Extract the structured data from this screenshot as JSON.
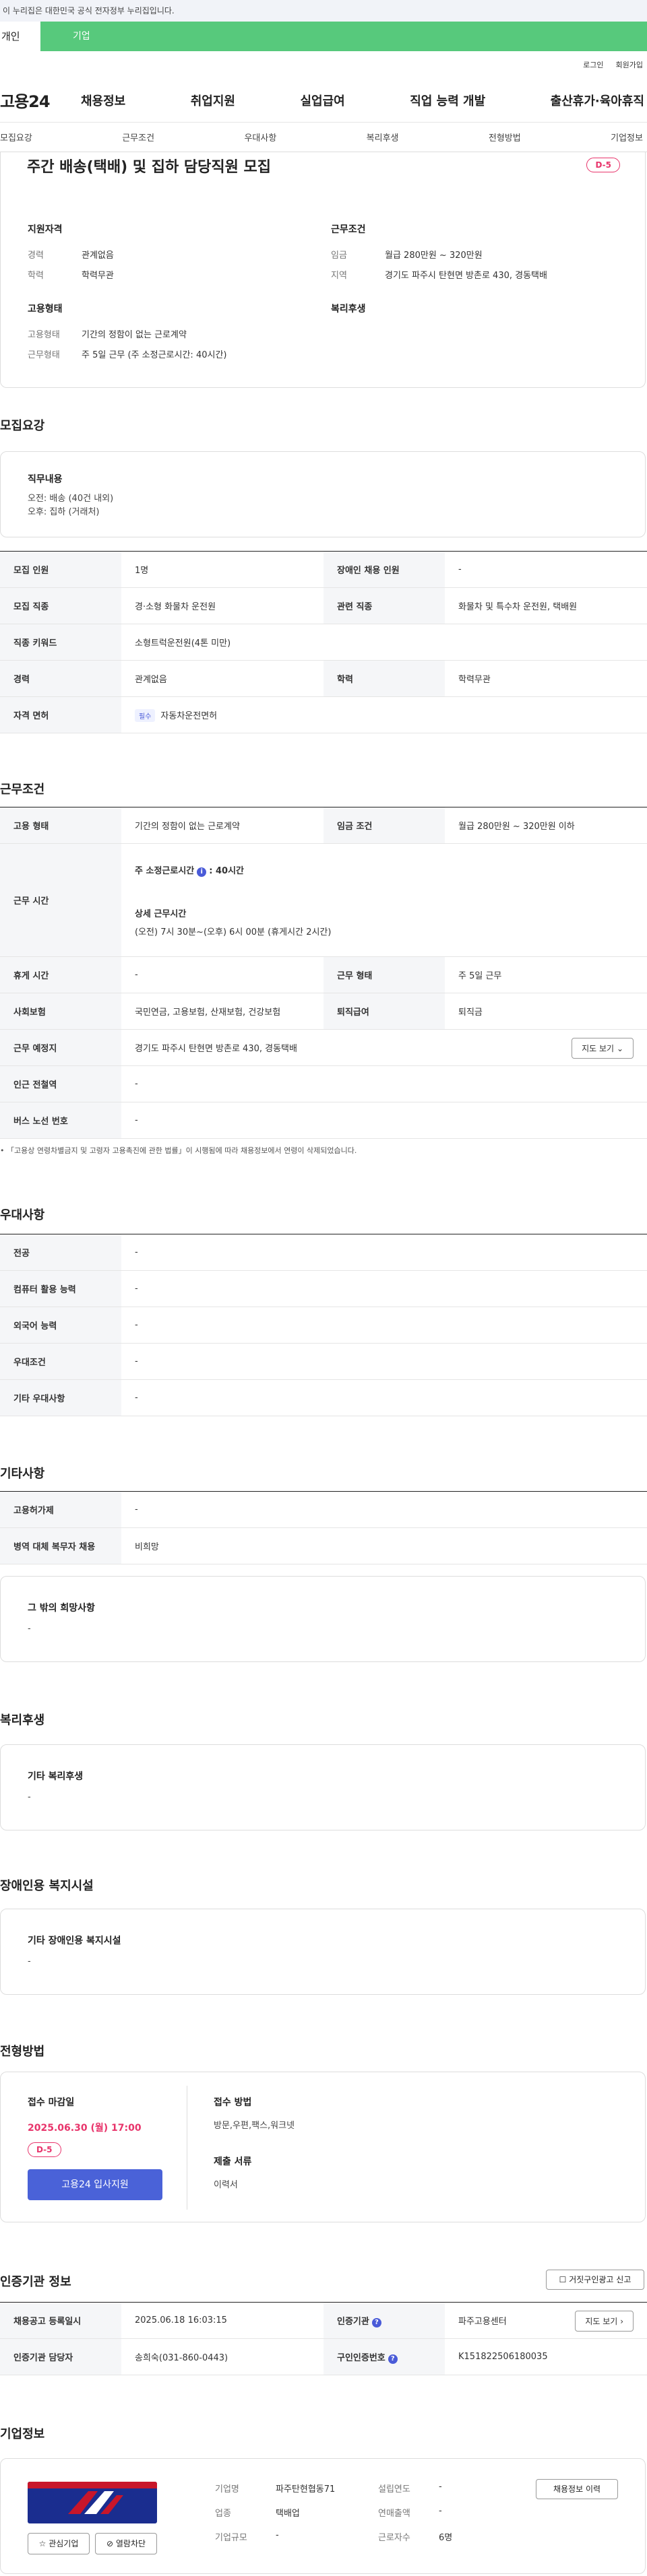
{
  "gov_banner": "이 누리집은 대한민국 공식 전자정부 누리집입니다.",
  "top_tabs": [
    "개인",
    "기업"
  ],
  "util_links": [
    "로그인",
    "회원가입"
  ],
  "logo": "고용24",
  "gnb": [
    "채용정보",
    "취업지원",
    "실업급여",
    "직업 능력 개발",
    "출산휴가·육아휴직"
  ],
  "lnb": [
    "모집요강",
    "근무조건",
    "우대사항",
    "복리후생",
    "전형방법",
    "기업정보"
  ],
  "job": {
    "title": "주간 배송(택배) 및 집하 담당직원 모집",
    "dday": "D-5"
  },
  "summary": {
    "qual_title": "지원자격",
    "qual": [
      {
        "k": "경력",
        "v": "관계없음"
      },
      {
        "k": "학력",
        "v": "학력무관"
      }
    ],
    "cond_title": "근무조건",
    "cond": [
      {
        "k": "임금",
        "v": "월급 280만원 ~ 320만원"
      },
      {
        "k": "지역",
        "v": "경기도 파주시 탄현면 방촌로 430, 경동택배"
      }
    ],
    "type_title": "고용형태",
    "type": [
      {
        "k": "고용형태",
        "v": "기간의 정함이 없는 근로계약"
      },
      {
        "k": "근무형태",
        "v": "주 5일 근무 (주 소정근로시간: 40시간)"
      }
    ],
    "welfare_title": "복리후생"
  },
  "recruit": {
    "title": "모집요강",
    "duty_title": "직무내용",
    "duty_lines": [
      "오전: 배송 (40건 내외)",
      "오후: 집하 (거래처)"
    ],
    "rows": [
      [
        {
          "k": "모집 인원",
          "v": "1명"
        },
        {
          "k": "장애인 채용 인원",
          "v": "-"
        }
      ],
      [
        {
          "k": "모집 직종",
          "v": "경·소형 화물차 운전원"
        },
        {
          "k": "관련 직종",
          "v": "화물차 및 특수차 운전원, 택배원"
        }
      ],
      [
        {
          "k": "직종 키워드",
          "v": "소형트럭운전원(4톤 미만)"
        }
      ],
      [
        {
          "k": "경력",
          "v": "관계없음"
        },
        {
          "k": "학력",
          "v": "학력무관"
        }
      ],
      [
        {
          "k": "자격 면허",
          "v": "자동차운전면허",
          "tag": "필수"
        }
      ]
    ]
  },
  "work": {
    "title": "근무조건",
    "employ_k": "고용 형태",
    "employ_v": "기간의 정함이 없는 근로계약",
    "wage_k": "임금 조건",
    "wage_v": "월급 280만원 ~ 320만원 이하",
    "time_k": "근무 시간",
    "time_main": "주 소정근로시간",
    "time_main_v": ": 40시간",
    "time_detail_title": "상세 근무시간",
    "time_detail": "(오전) 7시 30분~(오후) 6시 00분 (휴게시간 2시간)",
    "rest_k": "휴게 시간",
    "rest_v": "-",
    "shift_k": "근무 형태",
    "shift_v": "주 5일 근무",
    "ins_k": "사회보험",
    "ins_v": "국민연금, 고용보험, 산재보험, 건강보험",
    "sev_k": "퇴직급여",
    "sev_v": "퇴직금",
    "place_k": "근무 예정지",
    "place_v": "경기도 파주시 탄현면 방촌로 430, 경동택배",
    "map_btn": "지도 보기",
    "station_k": "인근 전철역",
    "station_v": "-",
    "bus_k": "버스 노선 번호",
    "bus_v": "-",
    "note": "「고용상 연령차별금지 및 고령자 고용촉진에 관한 법률」이 시행됨에 따라 채용정보에서 연령이 삭제되었습니다."
  },
  "pref": {
    "title": "우대사항",
    "rows": [
      {
        "k": "전공",
        "v": "-"
      },
      {
        "k": "컴퓨터 활용 능력",
        "v": "-"
      },
      {
        "k": "외국어 능력",
        "v": "-"
      },
      {
        "k": "우대조건",
        "v": "-"
      },
      {
        "k": "기타 우대사항",
        "v": "-"
      }
    ]
  },
  "etc": {
    "title": "기타사항",
    "rows": [
      {
        "k": "고용허가제",
        "v": "-"
      },
      {
        "k": "병역 대체 복무자 채용",
        "v": "비희망"
      }
    ],
    "hope_title": "그 밖의 희망사항",
    "hope_v": "-"
  },
  "welfare": {
    "title": "복리후생",
    "box_h": "기타 복리후생",
    "box_v": "-"
  },
  "disabled": {
    "title": "장애인용 복지시설",
    "box_h": "기타 장애인용 복지시설",
    "box_v": "-"
  },
  "process": {
    "title": "전형방법",
    "deadline_k": "접수 마감일",
    "deadline_v": "2025.06.30 (월) 17:00",
    "dday": "D-5",
    "apply_btn": "고용24 입사지원",
    "method_k": "접수 방법",
    "method_v": "방문,우편,팩스,워크넷",
    "doc_k": "제출 서류",
    "doc_v": "이력서"
  },
  "agency": {
    "title": "인증기관 정보",
    "report_btn": "거짓구인광고 신고",
    "rows": [
      [
        {
          "k": "채용공고 등록일시",
          "v": "2025.06.18 16:03:15"
        },
        {
          "k": "인증기관",
          "v": "파주고용센터"
        }
      ],
      [
        {
          "k": "인증기관 담당자",
          "v": "송희숙(031-860-0443)"
        },
        {
          "k": "구인인증번호",
          "v": "K151822506180035"
        }
      ]
    ],
    "map_btn": "지도 보기"
  },
  "company": {
    "title": "기업정보",
    "fields": [
      {
        "k": "기업명",
        "v": "파주탄현협동71"
      },
      {
        "k": "설립연도",
        "v": "-"
      },
      {
        "k": "업종",
        "v": "택배업"
      },
      {
        "k": "연매출액",
        "v": "-"
      },
      {
        "k": "기업규모",
        "v": "-"
      },
      {
        "k": "근로자수",
        "v": "6명"
      }
    ],
    "history_btn": "채용정보 이력",
    "fav_btn": "관심기업",
    "block_btn": "열람차단"
  }
}
